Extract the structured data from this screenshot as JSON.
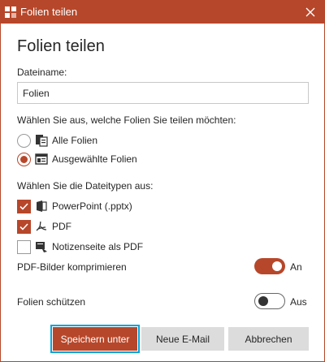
{
  "window": {
    "title": "Folien teilen",
    "accent_color": "#b7472a",
    "focus_color": "#0aa5d8"
  },
  "heading": "Folien teilen",
  "filename": {
    "label": "Dateiname:",
    "value": "Folien"
  },
  "slides": {
    "label": "Wählen Sie aus, welche Folien Sie teilen möchten:",
    "options": [
      {
        "label": "Alle Folien",
        "icon": "all-slides-icon",
        "selected": false
      },
      {
        "label": "Ausgewählte Folien",
        "icon": "selected-slides-icon",
        "selected": true
      }
    ]
  },
  "filetypes": {
    "label": "Wählen Sie die Dateitypen aus:",
    "options": [
      {
        "label": "PowerPoint (.pptx)",
        "icon": "powerpoint-icon",
        "checked": true
      },
      {
        "label": "PDF",
        "icon": "pdf-icon",
        "checked": true
      },
      {
        "label": "Notizenseite als PDF",
        "icon": "notes-pdf-icon",
        "checked": false
      }
    ]
  },
  "compress": {
    "label": "PDF-Bilder komprimieren",
    "state_label": "An",
    "on": true
  },
  "protect": {
    "label": "Folien schützen",
    "state_label": "Aus",
    "on": false
  },
  "buttons": {
    "save": "Speichern unter",
    "email": "Neue E-Mail",
    "cancel": "Abbrechen"
  }
}
